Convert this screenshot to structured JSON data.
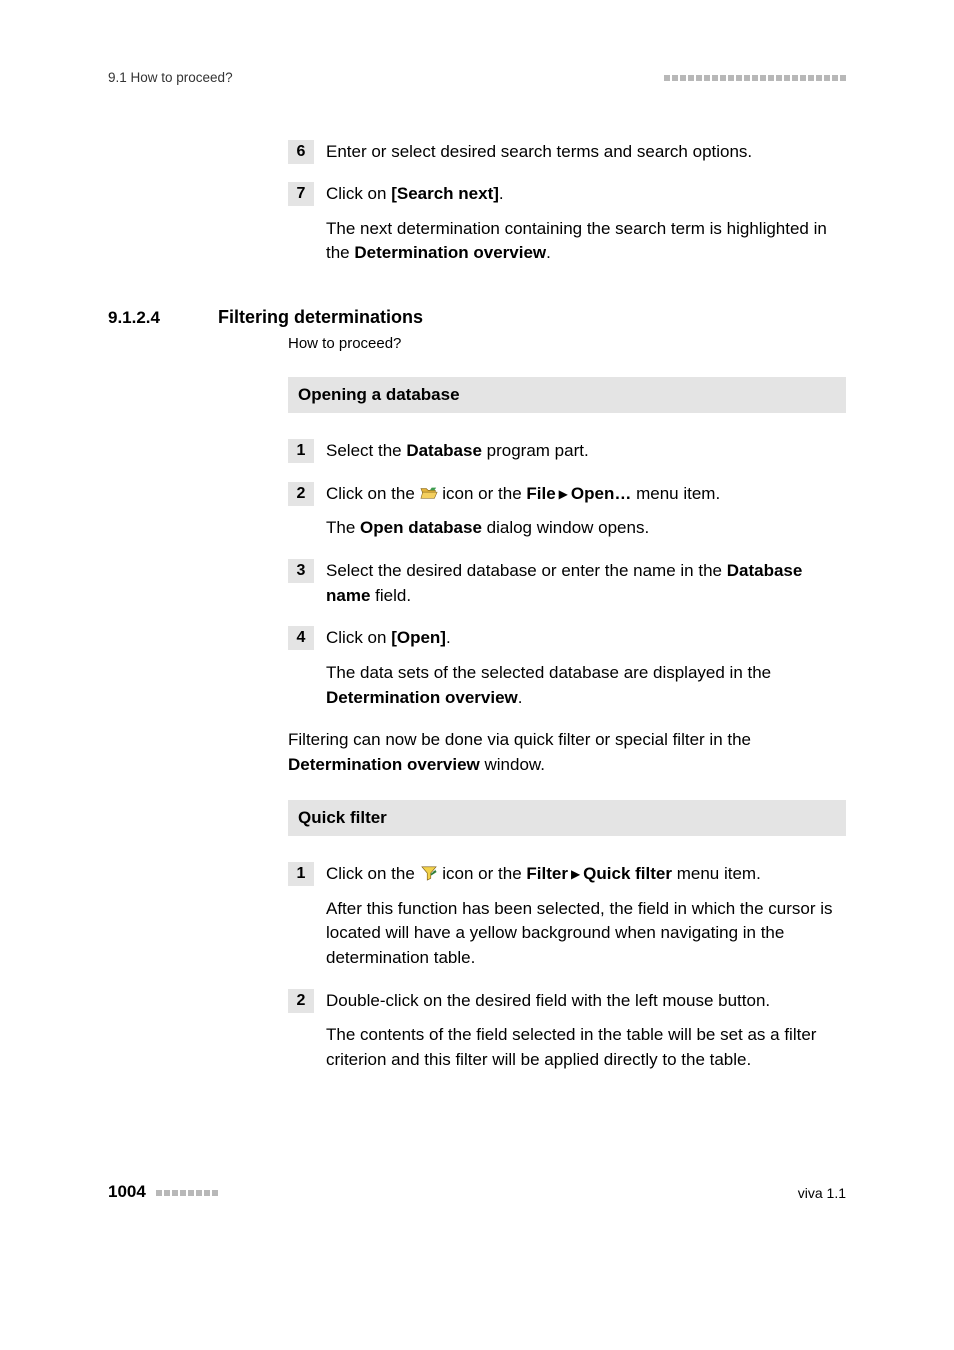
{
  "header": {
    "left": "9.1 How to proceed?"
  },
  "intro_steps": [
    {
      "num": "6",
      "paras": [
        {
          "runs": [
            {
              "t": "Enter or select desired search terms and search options."
            }
          ]
        }
      ]
    },
    {
      "num": "7",
      "paras": [
        {
          "runs": [
            {
              "t": "Click on "
            },
            {
              "t": "[Search next]",
              "b": true
            },
            {
              "t": "."
            }
          ]
        },
        {
          "runs": [
            {
              "t": "The next determination containing the search term is highlighted in the "
            },
            {
              "t": "Determination overview",
              "b": true
            },
            {
              "t": "."
            }
          ]
        }
      ]
    }
  ],
  "section": {
    "num": "9.1.2.4",
    "title": "Filtering determinations",
    "sub": "How to proceed?"
  },
  "proc1": {
    "title": "Opening a database",
    "steps": [
      {
        "num": "1",
        "paras": [
          {
            "runs": [
              {
                "t": "Select the "
              },
              {
                "t": "Database",
                "b": true
              },
              {
                "t": " program part."
              }
            ]
          }
        ]
      },
      {
        "num": "2",
        "paras": [
          {
            "runs": [
              {
                "t": "Click on the "
              },
              {
                "icon": "open"
              },
              {
                "t": " icon or the "
              },
              {
                "t": "File",
                "b": true
              },
              {
                "sep": true
              },
              {
                "t": "Open…",
                "b": true
              },
              {
                "t": " menu item."
              }
            ]
          },
          {
            "runs": [
              {
                "t": "The "
              },
              {
                "t": "Open database",
                "b": true
              },
              {
                "t": " dialog window opens."
              }
            ]
          }
        ]
      },
      {
        "num": "3",
        "paras": [
          {
            "runs": [
              {
                "t": "Select the desired database or enter the name in the "
              },
              {
                "t": "Database name",
                "b": true
              },
              {
                "t": " field."
              }
            ]
          }
        ]
      },
      {
        "num": "4",
        "paras": [
          {
            "runs": [
              {
                "t": "Click on "
              },
              {
                "t": "[Open]",
                "b": true
              },
              {
                "t": "."
              }
            ]
          },
          {
            "runs": [
              {
                "t": "The data sets of the selected database are displayed in the "
              },
              {
                "t": "Determination overview",
                "b": true
              },
              {
                "t": "."
              }
            ]
          }
        ]
      }
    ]
  },
  "midpara": {
    "runs": [
      {
        "t": "Filtering can now be done via quick filter or special filter in the "
      },
      {
        "t": "Determination overview",
        "b": true
      },
      {
        "t": " window."
      }
    ]
  },
  "proc2": {
    "title": "Quick filter",
    "steps": [
      {
        "num": "1",
        "paras": [
          {
            "runs": [
              {
                "t": "Click on the "
              },
              {
                "icon": "filter"
              },
              {
                "t": " icon or the "
              },
              {
                "t": "Filter",
                "b": true
              },
              {
                "sep": true
              },
              {
                "t": "Quick filter",
                "b": true
              },
              {
                "t": " menu item."
              }
            ]
          },
          {
            "runs": [
              {
                "t": "After this function has been selected, the field in which the cursor is located will have a yellow background when navigating in the determination table."
              }
            ]
          }
        ]
      },
      {
        "num": "2",
        "paras": [
          {
            "runs": [
              {
                "t": "Double-click on the desired field with the left mouse button."
              }
            ]
          },
          {
            "runs": [
              {
                "t": "The contents of the field selected in the table will be set as a filter criterion and this filter will be applied directly to the table."
              }
            ]
          }
        ]
      }
    ]
  },
  "footer": {
    "page": "1004",
    "right": "viva 1.1"
  },
  "icons": {
    "open": "folder-open-icon",
    "filter": "funnel-filter-icon"
  },
  "colors": {
    "step_bg": "#e4e4e4",
    "dash": "#b8b8b8"
  }
}
